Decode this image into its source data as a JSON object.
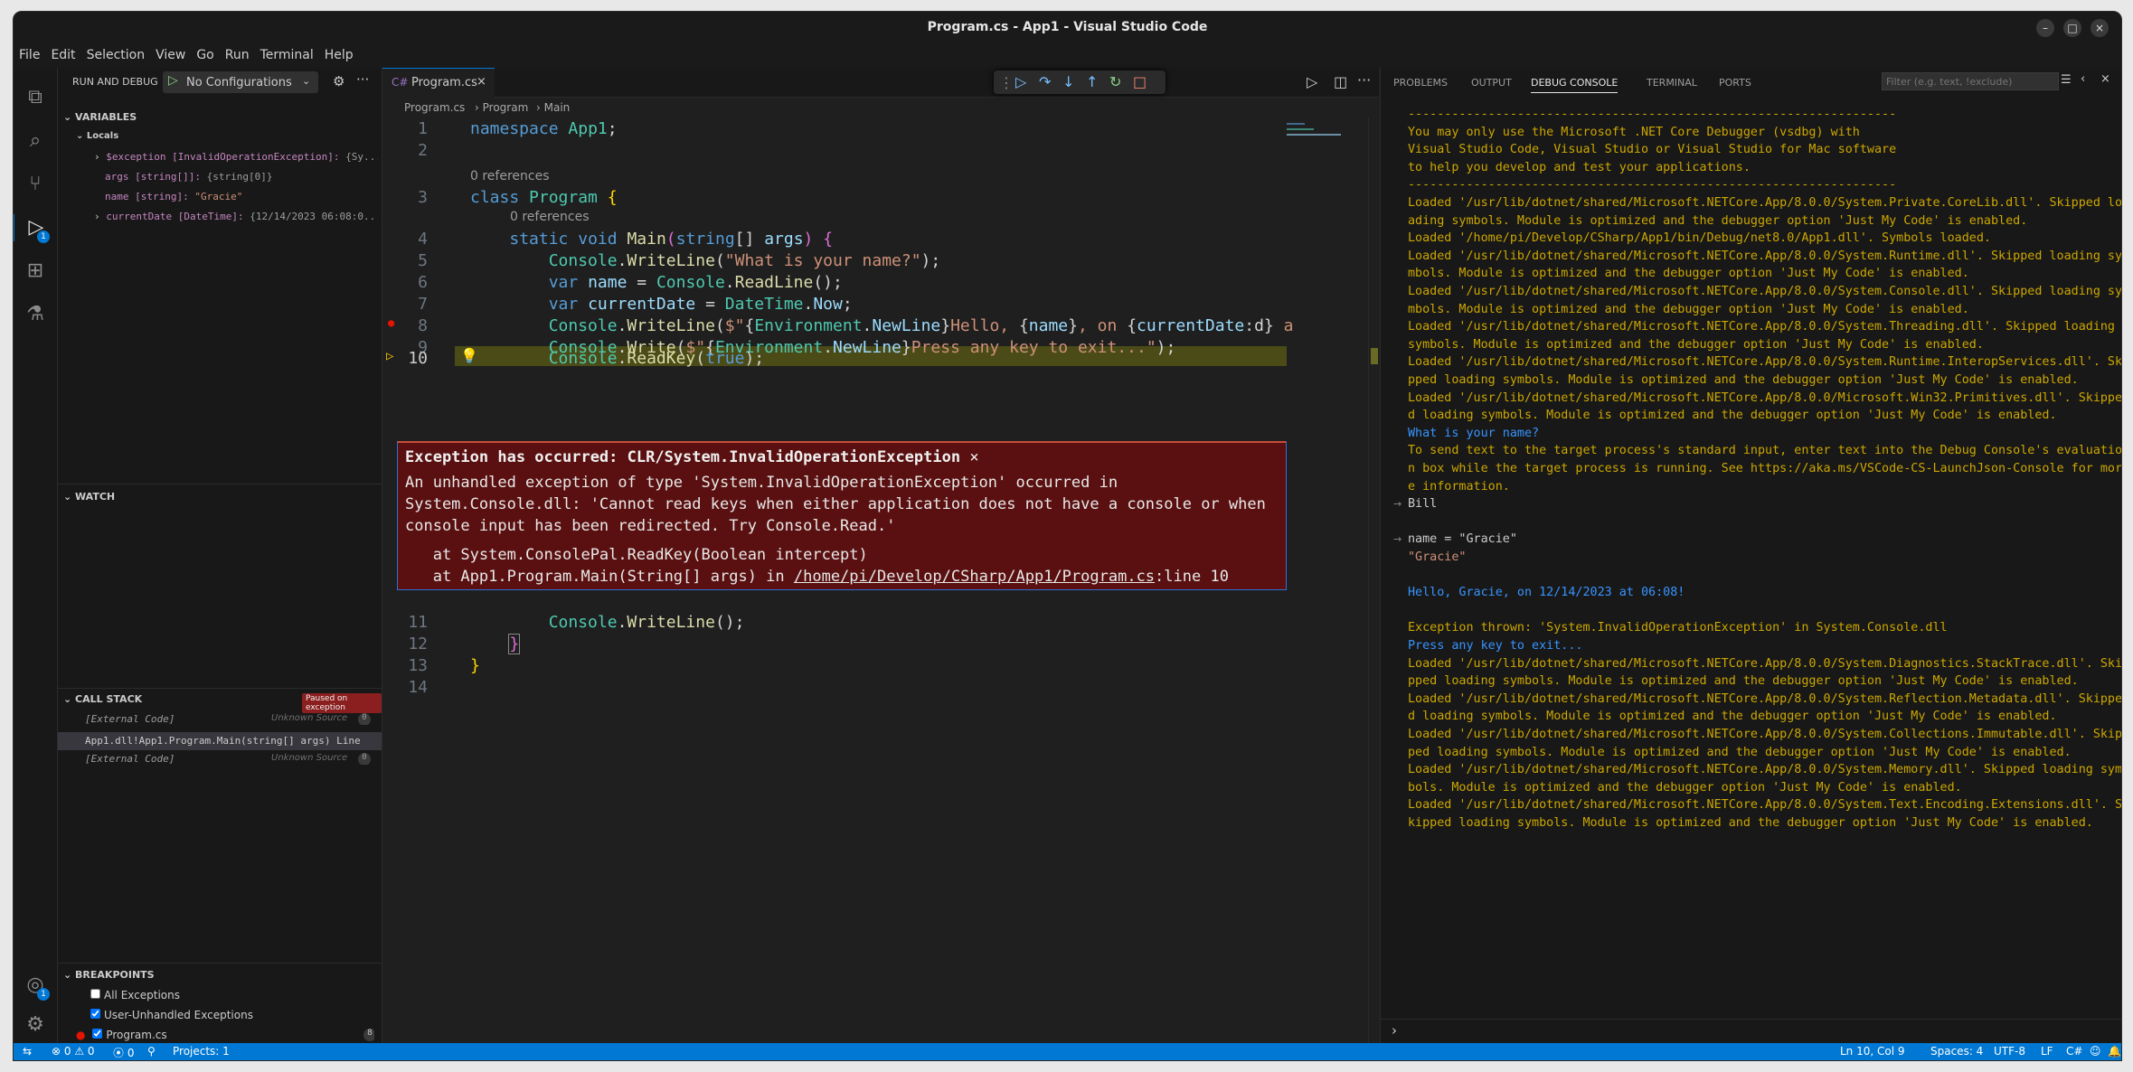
{
  "window": {
    "title": "Program.cs - App1 - Visual Studio Code",
    "minimize": "–",
    "maximize": "□",
    "close": "×"
  },
  "menu": [
    "File",
    "Edit",
    "Selection",
    "View",
    "Go",
    "Run",
    "Terminal",
    "Help"
  ],
  "activity": {
    "explorer": "⧉",
    "search": "⌕",
    "scm": "⑂",
    "debug": "▷",
    "debug_badge": "1",
    "extensions": "⊞",
    "testing": "⚗",
    "account": "◎",
    "account_badge": "1",
    "settings": "⚙"
  },
  "sidebar": {
    "title": "RUN AND DEBUG",
    "config": "No Configurations",
    "variables_title": "VARIABLES",
    "locals": "Locals",
    "vars": [
      {
        "name": "$exception [InvalidOperationException]:",
        "value": "{Sy..."
      },
      {
        "name": "args [string[]]:",
        "value": "{string[0]}"
      },
      {
        "name": "name [string]:",
        "value": "\"Gracie\""
      },
      {
        "name": "currentDate [DateTime]:",
        "value": "{12/14/2023 06:08:0..."
      }
    ],
    "watch_title": "WATCH",
    "callstack_title": "CALL STACK",
    "paused": "Paused on exception",
    "frames": [
      {
        "name": "[External Code]",
        "src": "Unknown Source",
        "n": "0"
      },
      {
        "name": "App1.dll!App1.Program.Main(string[] args) Line",
        "src": "",
        "n": ""
      },
      {
        "name": "[External Code]",
        "src": "Unknown Source",
        "n": "0"
      }
    ],
    "breakpoints_title": "BREAKPOINTS",
    "bps": [
      {
        "label": "All Exceptions",
        "checked": false
      },
      {
        "label": "User-Unhandled Exceptions",
        "checked": true
      },
      {
        "label": "Program.cs",
        "checked": true,
        "count": "8"
      }
    ]
  },
  "editor": {
    "tab": "Program.cs",
    "crumbs": [
      "Program.cs",
      "Program",
      "Main"
    ],
    "refs": "0 references",
    "exception": {
      "title": "Exception has occurred: CLR/System.InvalidOperationException",
      "l1": "An unhandled exception of type 'System.InvalidOperationException' occurred in",
      "l2": "System.Console.dll: 'Cannot read keys when either application does not have a console or when",
      "l3": "console input has been redirected. Try Console.Read.'",
      "st1": "   at System.ConsolePal.ReadKey(Boolean intercept)",
      "st2a": "   at App1.Program.Main(String[] args) in ",
      "st2b": "/home/pi/Develop/CSharp/App1/Program.cs",
      "st2c": ":line 10"
    },
    "line_numbers": [
      "1",
      "2",
      "3",
      "4",
      "5",
      "6",
      "7",
      "8",
      "9",
      "10",
      "11",
      "12",
      "13",
      "14"
    ]
  },
  "panel": {
    "tabs": [
      "PROBLEMS",
      "OUTPUT",
      "DEBUG CONSOLE",
      "TERMINAL",
      "PORTS"
    ],
    "filter_placeholder": "Filter (e.g. text, !exclude)",
    "lines": [
      {
        "c": "out",
        "t": "-------------------------------------------------------------------"
      },
      {
        "c": "out",
        "t": "You may only use the Microsoft .NET Core Debugger (vsdbg) with"
      },
      {
        "c": "out",
        "t": "Visual Studio Code, Visual Studio or Visual Studio for Mac software"
      },
      {
        "c": "out",
        "t": "to help you develop and test your applications."
      },
      {
        "c": "out",
        "t": "-------------------------------------------------------------------"
      },
      {
        "c": "out",
        "t": "Loaded '/usr/lib/dotnet/shared/Microsoft.NETCore.App/8.0.0/System.Private.CoreLib.dll'. Skipped lo"
      },
      {
        "c": "out",
        "t": "ading symbols. Module is optimized and the debugger option 'Just My Code' is enabled."
      },
      {
        "c": "out",
        "t": "Loaded '/home/pi/Develop/CSharp/App1/bin/Debug/net8.0/App1.dll'. Symbols loaded."
      },
      {
        "c": "out",
        "t": "Loaded '/usr/lib/dotnet/shared/Microsoft.NETCore.App/8.0.0/System.Runtime.dll'. Skipped loading sy"
      },
      {
        "c": "out",
        "t": "mbols. Module is optimized and the debugger option 'Just My Code' is enabled."
      },
      {
        "c": "out",
        "t": "Loaded '/usr/lib/dotnet/shared/Microsoft.NETCore.App/8.0.0/System.Console.dll'. Skipped loading sy"
      },
      {
        "c": "out",
        "t": "mbols. Module is optimized and the debugger option 'Just My Code' is enabled."
      },
      {
        "c": "out",
        "t": "Loaded '/usr/lib/dotnet/shared/Microsoft.NETCore.App/8.0.0/System.Threading.dll'. Skipped loading"
      },
      {
        "c": "out",
        "t": "symbols. Module is optimized and the debugger option 'Just My Code' is enabled."
      },
      {
        "c": "out",
        "t": "Loaded '/usr/lib/dotnet/shared/Microsoft.NETCore.App/8.0.0/System.Runtime.InteropServices.dll'. Ski"
      },
      {
        "c": "out",
        "t": "pped loading symbols. Module is optimized and the debugger option 'Just My Code' is enabled."
      },
      {
        "c": "out",
        "t": "Loaded '/usr/lib/dotnet/shared/Microsoft.NETCore.App/8.0.0/Microsoft.Win32.Primitives.dll'. Skippe"
      },
      {
        "c": "out",
        "t": "d loading symbols. Module is optimized and the debugger option 'Just My Code' is enabled."
      },
      {
        "c": "info",
        "t": "What is your name?"
      },
      {
        "c": "out",
        "t": "To send text to the target process's standard input, enter text into the Debug Console's evaluatio"
      },
      {
        "c": "out",
        "t": "n box while the target process is running. See https://aka.ms/VSCode-CS-LaunchJson-Console for mor"
      },
      {
        "c": "out",
        "t": "e information."
      },
      {
        "c": "inp",
        "t": "Bill"
      },
      {
        "c": "blank",
        "t": ""
      },
      {
        "c": "inp",
        "t": "name = \"Gracie\""
      },
      {
        "c": "strv",
        "t": "\"Gracie\""
      },
      {
        "c": "blank",
        "t": ""
      },
      {
        "c": "info",
        "t": "Hello, Gracie, on 12/14/2023 at 06:08!"
      },
      {
        "c": "blank",
        "t": ""
      },
      {
        "c": "out",
        "t": "Exception thrown: 'System.InvalidOperationException' in System.Console.dll"
      },
      {
        "c": "info",
        "t": "Press any key to exit..."
      },
      {
        "c": "out",
        "t": "Loaded '/usr/lib/dotnet/shared/Microsoft.NETCore.App/8.0.0/System.Diagnostics.StackTrace.dll'. Ski"
      },
      {
        "c": "out",
        "t": "pped loading symbols. Module is optimized and the debugger option 'Just My Code' is enabled."
      },
      {
        "c": "out",
        "t": "Loaded '/usr/lib/dotnet/shared/Microsoft.NETCore.App/8.0.0/System.Reflection.Metadata.dll'. Skippe"
      },
      {
        "c": "out",
        "t": "d loading symbols. Module is optimized and the debugger option 'Just My Code' is enabled."
      },
      {
        "c": "out",
        "t": "Loaded '/usr/lib/dotnet/shared/Microsoft.NETCore.App/8.0.0/System.Collections.Immutable.dll'. Skip"
      },
      {
        "c": "out",
        "t": "ped loading symbols. Module is optimized and the debugger option 'Just My Code' is enabled."
      },
      {
        "c": "out",
        "t": "Loaded '/usr/lib/dotnet/shared/Microsoft.NETCore.App/8.0.0/System.Memory.dll'. Skipped loading sym"
      },
      {
        "c": "out",
        "t": "bols. Module is optimized and the debugger option 'Just My Code' is enabled."
      },
      {
        "c": "out",
        "t": "Loaded '/usr/lib/dotnet/shared/Microsoft.NETCore.App/8.0.0/System.Text.Encoding.Extensions.dll'. S"
      },
      {
        "c": "out",
        "t": "kipped loading symbols. Module is optimized and the debugger option 'Just My Code' is enabled."
      }
    ],
    "prompt": "›"
  },
  "status": {
    "remote": "⇆",
    "problems": "⊗ 0 ⚠ 0",
    "ports": "⦿ 0",
    "projects": "Projects: 1",
    "position": "Ln 10, Col 9",
    "spaces": "Spaces: 4",
    "encoding": "UTF-8",
    "eol": "LF",
    "lang": "C#"
  }
}
